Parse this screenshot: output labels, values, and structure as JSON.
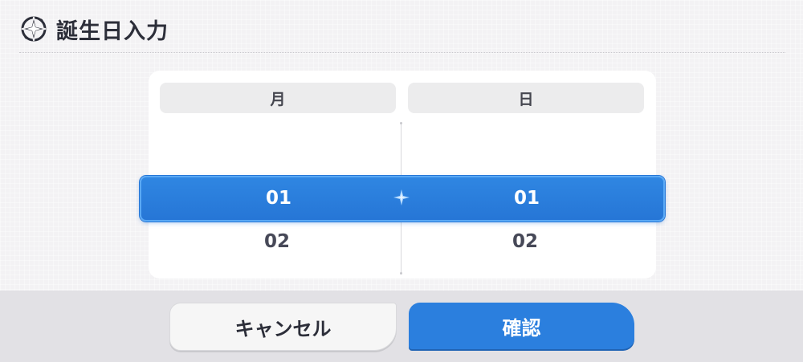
{
  "dialog": {
    "title": "誕生日入力",
    "icon": "compass-star-icon"
  },
  "picker": {
    "month_header": "月",
    "day_header": "日",
    "month_selected": "01",
    "day_selected": "01",
    "month_next": "02",
    "day_next": "02"
  },
  "buttons": {
    "cancel_label": "キャンセル",
    "confirm_label": "確認"
  },
  "colors": {
    "accent": "#2b7fde",
    "text_dark": "#2c2e39"
  }
}
